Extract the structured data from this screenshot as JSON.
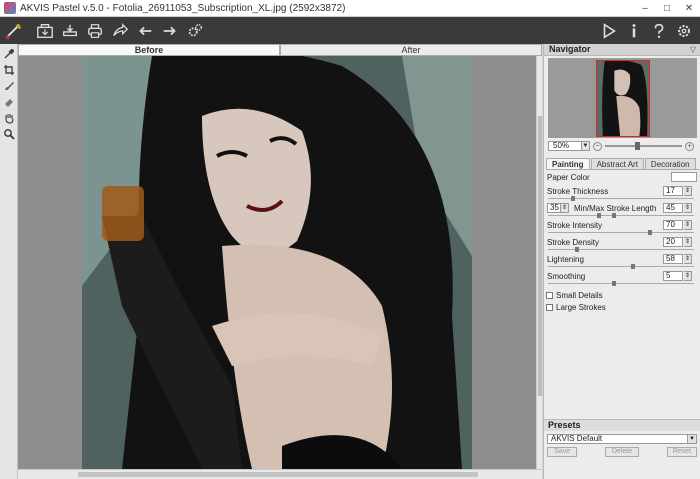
{
  "window": {
    "title": "AKVIS Pastel v.5.0 - Fotolia_26911053_Subscription_XL.jpg (2592x3872)",
    "minimize": "–",
    "maximize": "□",
    "close": "✕"
  },
  "toolbar": {
    "left_icons": [
      "logo-icon",
      "open-icon",
      "save-icon",
      "print-icon",
      "share-icon",
      "undo-icon",
      "redo-icon",
      "settings-icon"
    ],
    "right_icons": [
      "run-icon",
      "info-icon",
      "help-icon",
      "preferences-icon",
      "stop-icon"
    ]
  },
  "left_tools": [
    "eyedropper-icon",
    "crop-icon",
    "brush-icon",
    "eraser-icon",
    "hand-icon",
    "zoom-icon"
  ],
  "view_tabs": [
    "Before",
    "After"
  ],
  "navigator": {
    "title": "Navigator",
    "zoom": "50%",
    "zoom_level": 0.42
  },
  "settings_tabs": [
    "Painting",
    "Abstract Art",
    "Decoration"
  ],
  "params": {
    "paper_color_label": "Paper Color",
    "paper_color": "#ffffff",
    "stroke_thickness_label": "Stroke Thickness",
    "stroke_thickness": "17",
    "stroke_thickness_level": 0.17,
    "length_label": "Min/Max Stroke Length",
    "length_min": "35",
    "length_max": "45",
    "length_min_level": 0.35,
    "length_max_level": 0.45,
    "intensity_label": "Stroke Intensity",
    "intensity": "70",
    "intensity_level": 0.7,
    "density_label": "Stroke Density",
    "density": "20",
    "density_level": 0.2,
    "lightening_label": "Lightening",
    "lightening": "58",
    "lightening_level": 0.58,
    "smoothing_label": "Smoothing",
    "smoothing": "5",
    "smoothing_level": 0.45,
    "small_details_label": "Small Details",
    "large_strokes_label": "Large Strokes"
  },
  "presets": {
    "title": "Presets",
    "selected": "AKVIS Default",
    "save": "Save",
    "delete": "Delete",
    "reset": "Reset"
  },
  "colors": {
    "toolbar_bg": "#3a3a3a",
    "canvas_bg": "#8e8e8e",
    "stop_red": "#d9201d",
    "navigator_frame": "#dd2222"
  }
}
